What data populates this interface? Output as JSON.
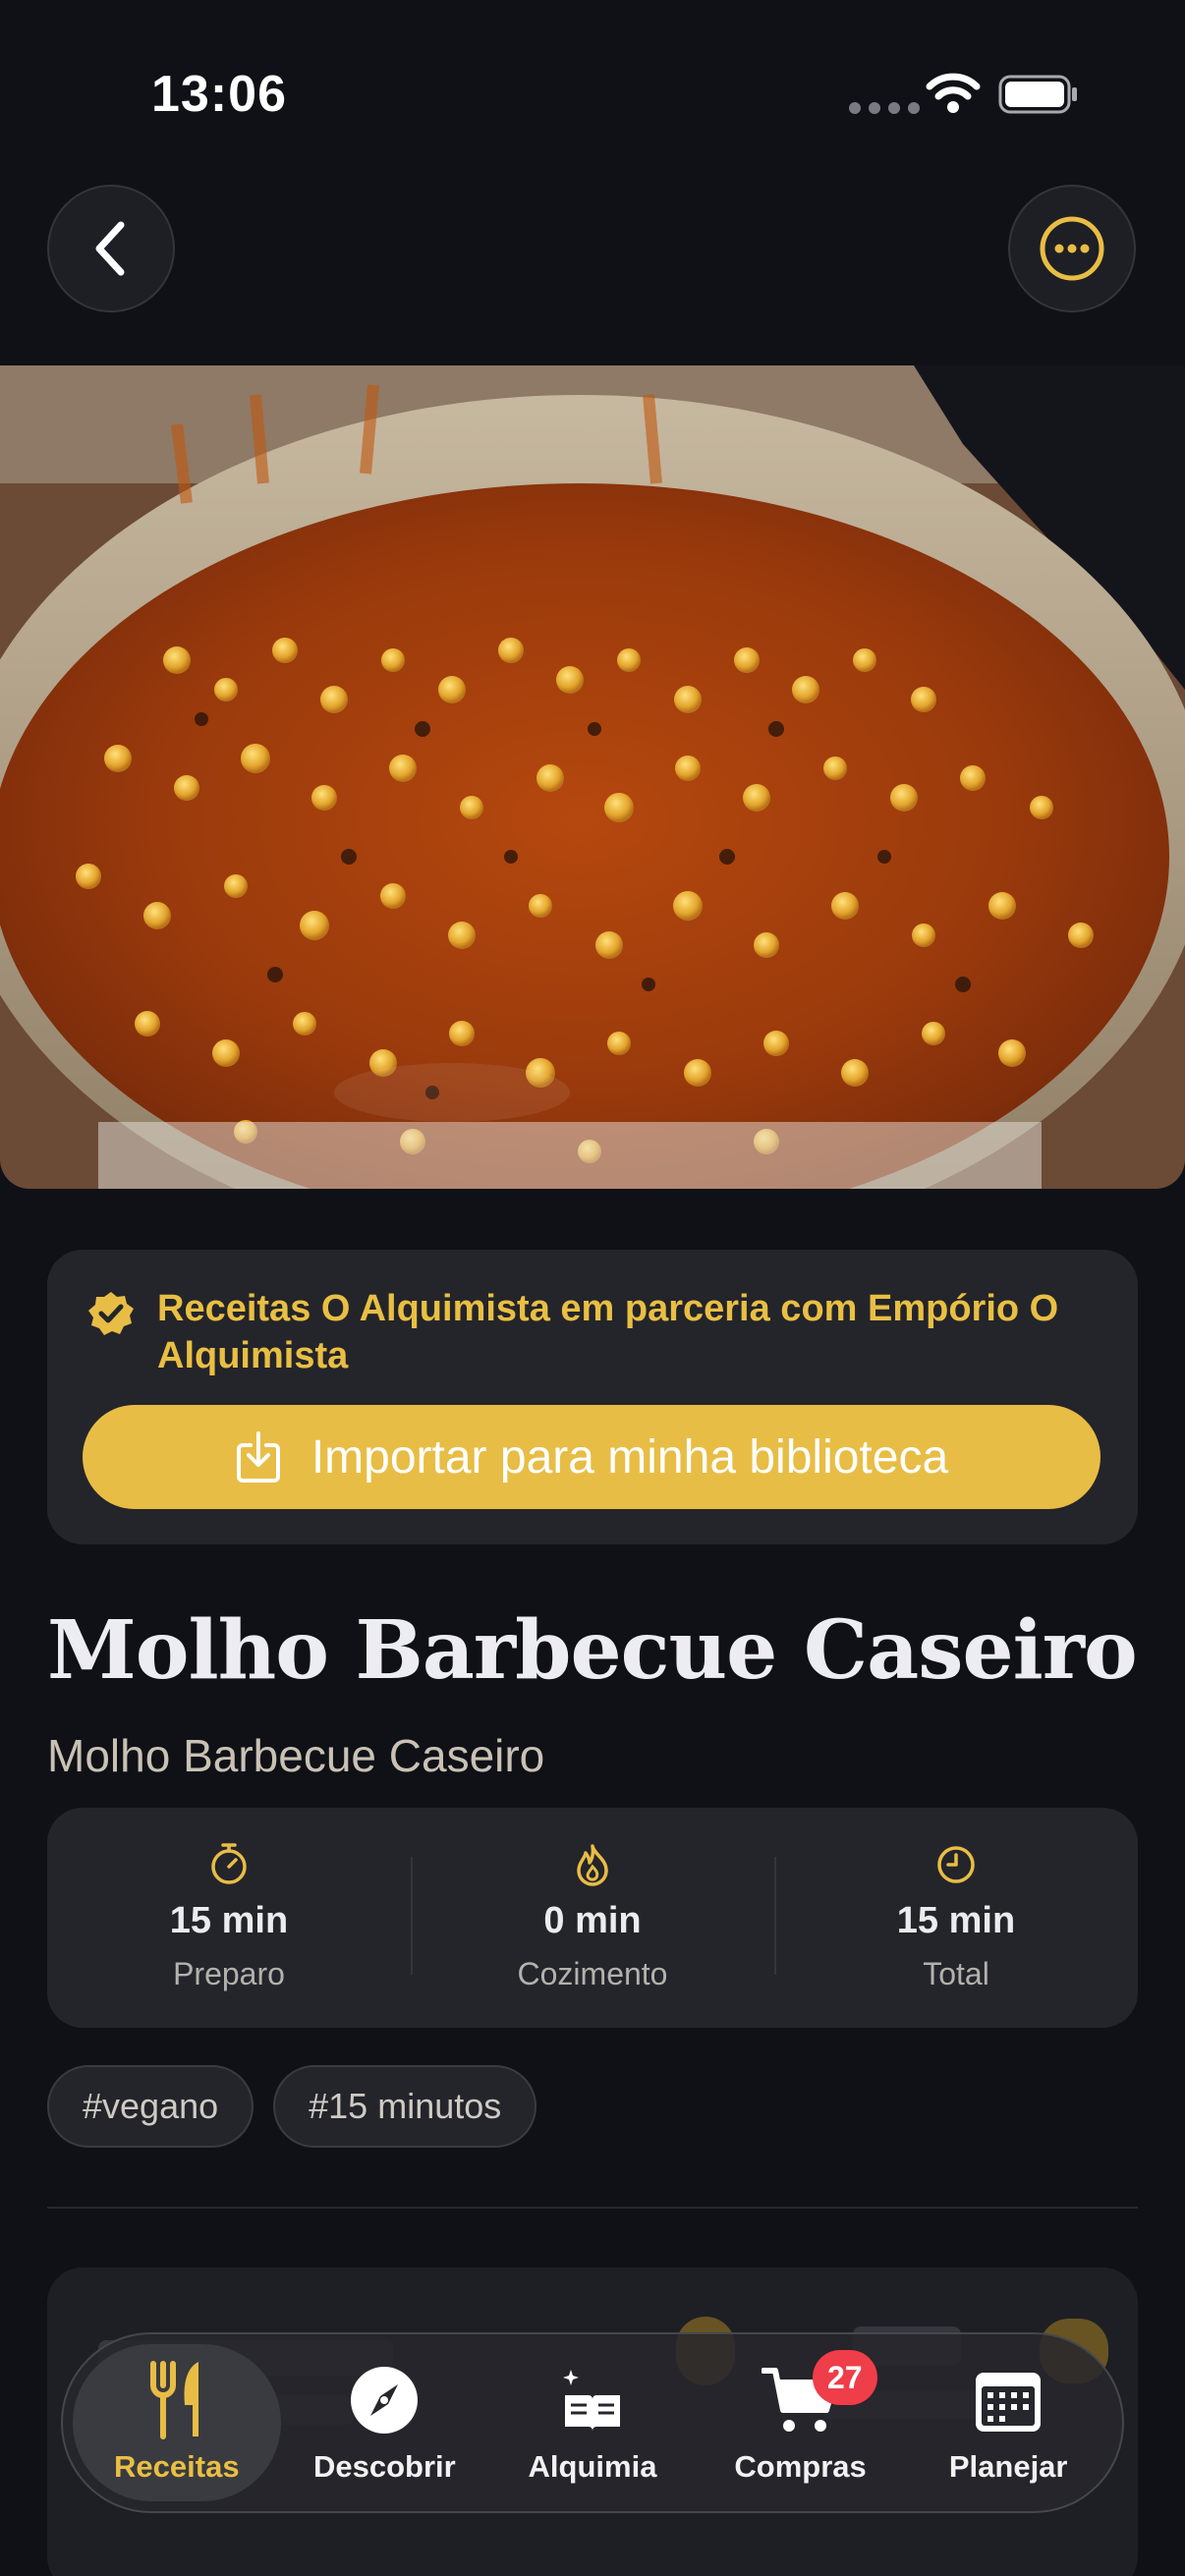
{
  "status_bar": {
    "time": "13:06"
  },
  "partner": {
    "text": "Receitas O Alquimista em parceria com Empório O Alquimista",
    "import_label": "Importar para minha biblioteca"
  },
  "recipe": {
    "title": "Molho Barbecue Caseiro",
    "subtitle": "Molho Barbecue Caseiro"
  },
  "times": [
    {
      "value": "15 min",
      "label": "Preparo",
      "icon": "timer-icon"
    },
    {
      "value": "0 min",
      "label": "Cozimento",
      "icon": "flame-icon"
    },
    {
      "value": "15 min",
      "label": "Total",
      "icon": "clock-icon"
    }
  ],
  "tags": [
    "#vegano",
    "#15 minutos"
  ],
  "tab_bar": {
    "tabs": [
      {
        "label": "Receitas",
        "icon": "fork-knife-icon",
        "active": true
      },
      {
        "label": "Descobrir",
        "icon": "compass-icon"
      },
      {
        "label": "Alquimia",
        "icon": "magic-book-icon"
      },
      {
        "label": "Compras",
        "icon": "cart-icon",
        "badge": "27"
      },
      {
        "label": "Planejar",
        "icon": "calendar-icon"
      }
    ]
  },
  "colors": {
    "background": "#101117",
    "card": "#24252B",
    "accent": "#E8BD45",
    "badge": "#EF3D49"
  }
}
